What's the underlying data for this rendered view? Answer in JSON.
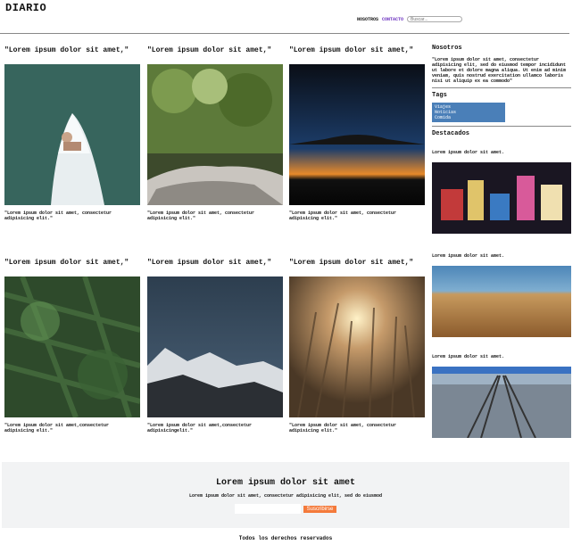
{
  "header": {
    "title": "DIARIO",
    "nav": [
      {
        "label": "NOSOTROS",
        "active": false
      },
      {
        "label": "CONTACTO",
        "active": true
      }
    ],
    "search_placeholder": "Buscar..."
  },
  "cards": [
    {
      "title": "\"Lorem ipsum dolor sit amet,\"",
      "image": "person-on-boat",
      "caption": "\"Lorem ipsum dolor sit amet, consectetur adipisicing elit.\""
    },
    {
      "title": "\"Lorem ipsum dolor sit amet,\"",
      "image": "forest-rock",
      "caption": "\"Lorem ipsum dolor sit amet, consectetur adipisicing elit.\""
    },
    {
      "title": "\"Lorem ipsum dolor sit amet,\"",
      "image": "sunset-horizon",
      "caption": "\"Lorem ipsum dolor sit amet, consectetur adipisicing elit.\""
    },
    {
      "title": "\"Lorem ipsum dolor sit amet,\"",
      "image": "pine-branches",
      "caption": "\"Lorem ipsum dolor sit amet,consectetur adipisicing elit.\""
    },
    {
      "title": "\"Lorem ipsum dolor sit amet,\"",
      "image": "snowy-mountains",
      "caption": "\"Lorem ipsum dolor sit amet,consectetur adipisicingelit.\""
    },
    {
      "title": "\"Lorem ipsum dolor sit amet,\"",
      "image": "tall-grass-sun",
      "caption": "\"Lorem ipsum dolor sit amet, consectetur adipisicing elit.\""
    }
  ],
  "sidebar": {
    "about_heading": "Nosotros",
    "about_text": "\"Lorem ipsum dolor sit amet, consectetur adipisicing elit, sed do eiusmod tempor incididunt ut labore et dolore magna aliqua. Ut enim ad minim veniam, quis nostrud exercitation ullamco laboris nisi ut aliquip ex ea commodo\"",
    "tags_heading": "Tags",
    "tags": [
      "Viajes",
      "Noticias",
      "Comida"
    ],
    "featured_heading": "Destacados",
    "featured": [
      {
        "text": "Lorem ipsum dolor sit amet.",
        "image": "city-night"
      },
      {
        "text": "Lorem ipsum dolor sit amet.",
        "image": "beach-sand"
      },
      {
        "text": "Lorem ipsum dolor sit amet.",
        "image": "railway-tracks"
      }
    ]
  },
  "footer": {
    "title": "Lorem ipsum dolor sit amet",
    "subtitle": "Lorem ipsum dolor sit amet, consectetur adipisicing elit, sed do eiusmod",
    "subscribe_label": "Suscribirse",
    "copyright": "Todos los derechos reservados"
  }
}
